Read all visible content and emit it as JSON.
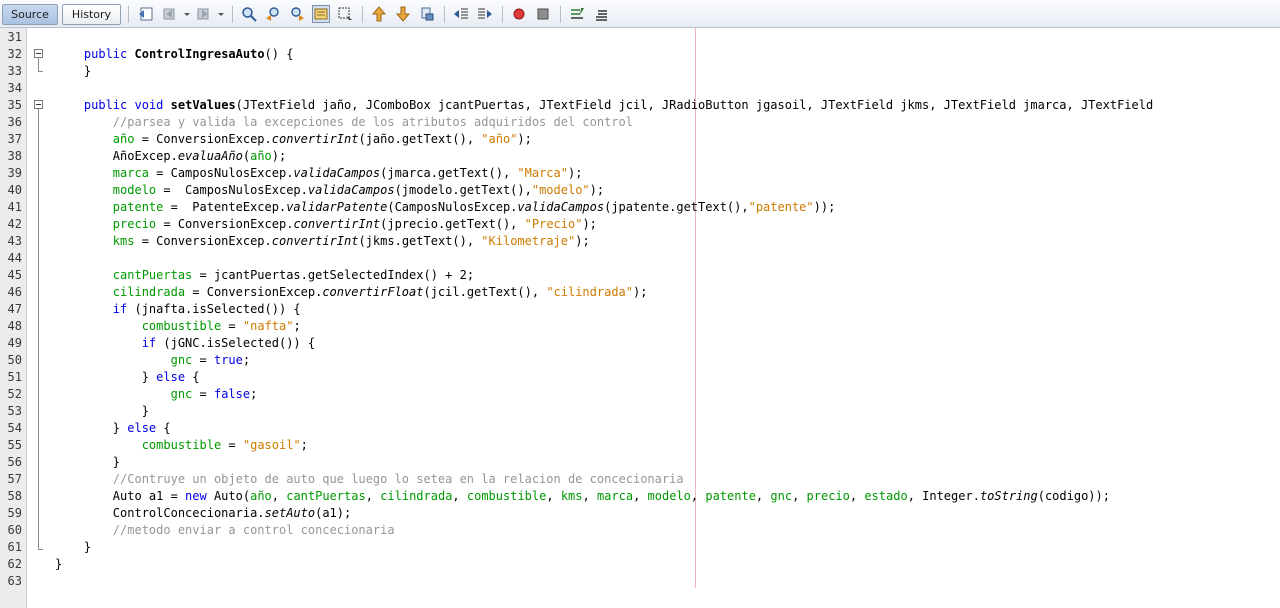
{
  "tabs": {
    "source_label": "Source",
    "history_label": "History"
  },
  "toolbar": {
    "icons": [
      "last-edit-icon",
      "back-icon",
      "forward-icon",
      "find-selection-icon",
      "find-previous-icon",
      "find-next-icon",
      "toggle-highlight-icon",
      "toggle-rect-selection-icon",
      "previous-bookmark-icon",
      "next-bookmark-icon",
      "toggle-bookmark-icon",
      "shift-left-icon",
      "shift-right-icon",
      "start-macro-icon",
      "stop-macro-icon",
      "comment-icon",
      "uncomment-icon"
    ]
  },
  "colors": {
    "keyword": "#0000e6",
    "field": "#009900",
    "string": "#ce7b00",
    "comment": "#969696"
  },
  "lines": [
    {
      "no": "31",
      "t": []
    },
    {
      "no": "32",
      "t": [
        [
          "",
          "    "
        ],
        [
          "kw",
          "public"
        ],
        [
          "",
          " "
        ],
        [
          "bd",
          "ControlIngresaAuto"
        ],
        [
          "",
          "() {"
        ]
      ]
    },
    {
      "no": "33",
      "t": [
        [
          "",
          "    }"
        ]
      ]
    },
    {
      "no": "34",
      "t": []
    },
    {
      "no": "35",
      "t": [
        [
          "",
          "    "
        ],
        [
          "kw",
          "public"
        ],
        [
          "",
          " "
        ],
        [
          "kw",
          "void"
        ],
        [
          "",
          " "
        ],
        [
          "bd",
          "setValues"
        ],
        [
          "",
          "(JTextField jaño, JComboBox jcantPuertas, JTextField jcil, JRadioButton jgasoil, JTextField jkms, JTextField jmarca, JTextField"
        ]
      ]
    },
    {
      "no": "36",
      "t": [
        [
          "",
          "        "
        ],
        [
          "cmt",
          "//parsea y valida la excepciones de los atributos adquiridos del control"
        ]
      ]
    },
    {
      "no": "37",
      "t": [
        [
          "",
          "        "
        ],
        [
          "fld",
          "año"
        ],
        [
          "",
          " = ConversionExcep."
        ],
        [
          "it",
          "convertirInt"
        ],
        [
          "",
          "(jaño.getText(), "
        ],
        [
          "str",
          "\"año\""
        ],
        [
          "",
          ");"
        ]
      ]
    },
    {
      "no": "38",
      "t": [
        [
          "",
          "        AñoExcep."
        ],
        [
          "it",
          "evaluaAño"
        ],
        [
          "",
          "("
        ],
        [
          "fld",
          "año"
        ],
        [
          "",
          ");"
        ]
      ]
    },
    {
      "no": "39",
      "t": [
        [
          "",
          "        "
        ],
        [
          "fld",
          "marca"
        ],
        [
          "",
          " = CamposNulosExcep."
        ],
        [
          "it",
          "validaCampos"
        ],
        [
          "",
          "(jmarca.getText(), "
        ],
        [
          "str",
          "\"Marca\""
        ],
        [
          "",
          ");"
        ]
      ]
    },
    {
      "no": "40",
      "t": [
        [
          "",
          "        "
        ],
        [
          "fld",
          "modelo"
        ],
        [
          "",
          " =  CamposNulosExcep."
        ],
        [
          "it",
          "validaCampos"
        ],
        [
          "",
          "(jmodelo.getText(),"
        ],
        [
          "str",
          "\"modelo\""
        ],
        [
          "",
          ");"
        ]
      ]
    },
    {
      "no": "41",
      "t": [
        [
          "",
          "        "
        ],
        [
          "fld",
          "patente"
        ],
        [
          "",
          " =  PatenteExcep."
        ],
        [
          "it",
          "validarPatente"
        ],
        [
          "",
          "(CamposNulosExcep."
        ],
        [
          "it",
          "validaCampos"
        ],
        [
          "",
          "(jpatente.getText(),"
        ],
        [
          "str",
          "\"patente\""
        ],
        [
          "",
          "));"
        ]
      ]
    },
    {
      "no": "42",
      "t": [
        [
          "",
          "        "
        ],
        [
          "fld",
          "precio"
        ],
        [
          "",
          " = ConversionExcep."
        ],
        [
          "it",
          "convertirInt"
        ],
        [
          "",
          "(jprecio.getText(), "
        ],
        [
          "str",
          "\"Precio\""
        ],
        [
          "",
          ");"
        ]
      ]
    },
    {
      "no": "43",
      "t": [
        [
          "",
          "        "
        ],
        [
          "fld",
          "kms"
        ],
        [
          "",
          " = ConversionExcep."
        ],
        [
          "it",
          "convertirInt"
        ],
        [
          "",
          "(jkms.getText(), "
        ],
        [
          "str",
          "\"Kilometraje\""
        ],
        [
          "",
          ");"
        ]
      ]
    },
    {
      "no": "44",
      "t": []
    },
    {
      "no": "45",
      "t": [
        [
          "",
          "        "
        ],
        [
          "fld",
          "cantPuertas"
        ],
        [
          "",
          " = jcantPuertas.getSelectedIndex() + 2;"
        ]
      ]
    },
    {
      "no": "46",
      "t": [
        [
          "",
          "        "
        ],
        [
          "fld",
          "cilindrada"
        ],
        [
          "",
          " = ConversionExcep."
        ],
        [
          "it",
          "convertirFloat"
        ],
        [
          "",
          "(jcil.getText(), "
        ],
        [
          "str",
          "\"cilindrada\""
        ],
        [
          "",
          ");"
        ]
      ]
    },
    {
      "no": "47",
      "t": [
        [
          "",
          "        "
        ],
        [
          "kw",
          "if"
        ],
        [
          "",
          " (jnafta.isSelected()) {"
        ]
      ]
    },
    {
      "no": "48",
      "t": [
        [
          "",
          "            "
        ],
        [
          "fld",
          "combustible"
        ],
        [
          "",
          " = "
        ],
        [
          "str",
          "\"nafta\""
        ],
        [
          "",
          ";"
        ]
      ]
    },
    {
      "no": "49",
      "t": [
        [
          "",
          "            "
        ],
        [
          "kw",
          "if"
        ],
        [
          "",
          " (jGNC.isSelected()) {"
        ]
      ]
    },
    {
      "no": "50",
      "t": [
        [
          "",
          "                "
        ],
        [
          "fld",
          "gnc"
        ],
        [
          "",
          " = "
        ],
        [
          "kw",
          "true"
        ],
        [
          "",
          ";"
        ]
      ]
    },
    {
      "no": "51",
      "t": [
        [
          "",
          "            } "
        ],
        [
          "kw",
          "else"
        ],
        [
          "",
          " {"
        ]
      ]
    },
    {
      "no": "52",
      "t": [
        [
          "",
          "                "
        ],
        [
          "fld",
          "gnc"
        ],
        [
          "",
          " = "
        ],
        [
          "kw",
          "false"
        ],
        [
          "",
          ";"
        ]
      ]
    },
    {
      "no": "53",
      "t": [
        [
          "",
          "            }"
        ]
      ]
    },
    {
      "no": "54",
      "t": [
        [
          "",
          "        } "
        ],
        [
          "kw",
          "else"
        ],
        [
          "",
          " {"
        ]
      ]
    },
    {
      "no": "55",
      "t": [
        [
          "",
          "            "
        ],
        [
          "fld",
          "combustible"
        ],
        [
          "",
          " = "
        ],
        [
          "str",
          "\"gasoil\""
        ],
        [
          "",
          ";"
        ]
      ]
    },
    {
      "no": "56",
      "t": [
        [
          "",
          "        }"
        ]
      ]
    },
    {
      "no": "57",
      "t": [
        [
          "",
          "        "
        ],
        [
          "cmt",
          "//Contruye un objeto de auto que luego lo setea en la relacion de concecionaria"
        ]
      ]
    },
    {
      "no": "58",
      "t": [
        [
          "",
          "        Auto a1 = "
        ],
        [
          "kw",
          "new"
        ],
        [
          "",
          " Auto("
        ],
        [
          "fld",
          "año"
        ],
        [
          "",
          ", "
        ],
        [
          "fld",
          "cantPuertas"
        ],
        [
          "",
          ", "
        ],
        [
          "fld",
          "cilindrada"
        ],
        [
          "",
          ", "
        ],
        [
          "fld",
          "combustible"
        ],
        [
          "",
          ", "
        ],
        [
          "fld",
          "kms"
        ],
        [
          "",
          ", "
        ],
        [
          "fld",
          "marca"
        ],
        [
          "",
          ", "
        ],
        [
          "fld",
          "modelo"
        ],
        [
          "",
          ", "
        ],
        [
          "fld",
          "patente"
        ],
        [
          "",
          ", "
        ],
        [
          "fld",
          "gnc"
        ],
        [
          "",
          ", "
        ],
        [
          "fld",
          "precio"
        ],
        [
          "",
          ", "
        ],
        [
          "fld",
          "estado"
        ],
        [
          "",
          ", Integer."
        ],
        [
          "it",
          "toString"
        ],
        [
          "",
          "(codigo));"
        ]
      ]
    },
    {
      "no": "59",
      "t": [
        [
          "",
          "        ControlConcecionaria."
        ],
        [
          "it",
          "setAuto"
        ],
        [
          "",
          "(a1);"
        ]
      ]
    },
    {
      "no": "60",
      "t": [
        [
          "",
          "        "
        ],
        [
          "cmt",
          "//metodo enviar a control concecionaria"
        ]
      ]
    },
    {
      "no": "61",
      "t": [
        [
          "",
          "    }"
        ]
      ]
    },
    {
      "no": "62",
      "t": [
        [
          "",
          "}"
        ]
      ]
    },
    {
      "no": "63",
      "t": []
    }
  ]
}
